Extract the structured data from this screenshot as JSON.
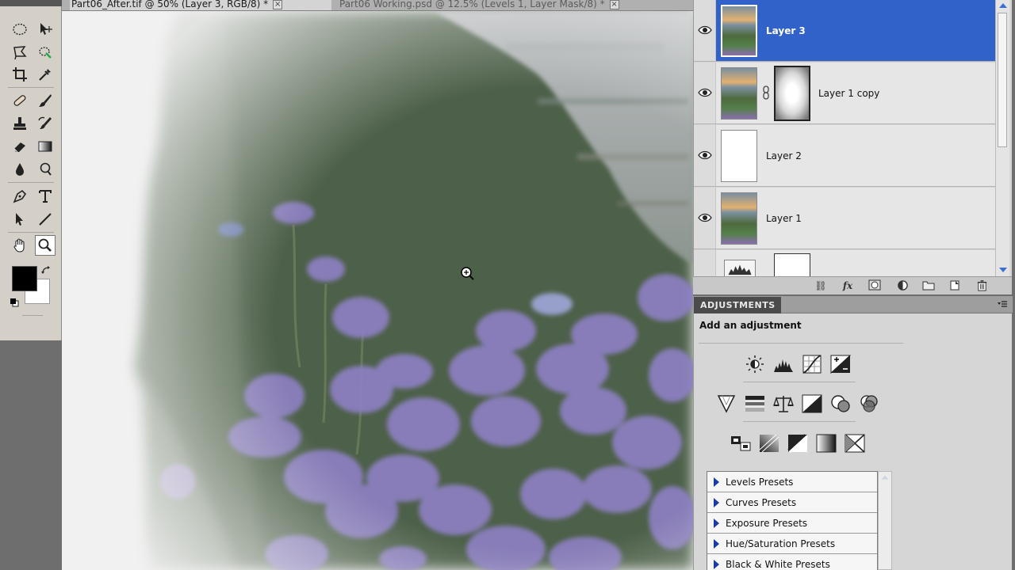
{
  "document_tabs": [
    {
      "title": "Part06_After.tif @ 50% (Layer 3, RGB/8) *",
      "active": true
    },
    {
      "title": "Part06 Working.psd @ 12.5% (Levels 1, Layer Mask/8) *",
      "active": false
    }
  ],
  "tools": [
    "elliptical-marquee",
    "move",
    "lasso",
    "quick-selection",
    "crop",
    "eyedropper",
    "spot-healing-brush",
    "brush",
    "clone-stamp",
    "history-brush",
    "eraser",
    "gradient",
    "blur",
    "dodge",
    "pen",
    "type",
    "path-selection",
    "line",
    "hand",
    "zoom"
  ],
  "colors": {
    "foreground": "#000000",
    "background": "#ffffff",
    "selection": "#3162c9"
  },
  "layers": [
    {
      "name": "Layer 3",
      "selected": true,
      "visible": true,
      "thumb": "photo"
    },
    {
      "name": "Layer 1 copy",
      "selected": false,
      "visible": true,
      "thumb": "photo",
      "has_mask": true
    },
    {
      "name": "Layer 2",
      "selected": false,
      "visible": true,
      "thumb": "white"
    },
    {
      "name": "Layer 1",
      "selected": false,
      "visible": true,
      "thumb": "photo"
    }
  ],
  "layers_footer_icons": [
    "link-icon",
    "fx-icon",
    "add-mask-icon",
    "adjustment-layer-icon",
    "group-folder-icon",
    "new-layer-icon",
    "trash-icon"
  ],
  "adjustments": {
    "tab_label": "ADJUSTMENTS",
    "subtitle": "Add an adjustment",
    "icons": [
      "brightness-contrast",
      "levels",
      "curves",
      "exposure",
      "vibrance",
      "hue-saturation",
      "color-balance",
      "black-white",
      "photo-filter",
      "channel-mixer",
      "invert",
      "posterize",
      "threshold",
      "gradient-map",
      "selective-color"
    ],
    "presets": [
      "Levels Presets",
      "Curves Presets",
      "Exposure Presets",
      "Hue/Saturation Presets",
      "Black & White Presets"
    ]
  }
}
